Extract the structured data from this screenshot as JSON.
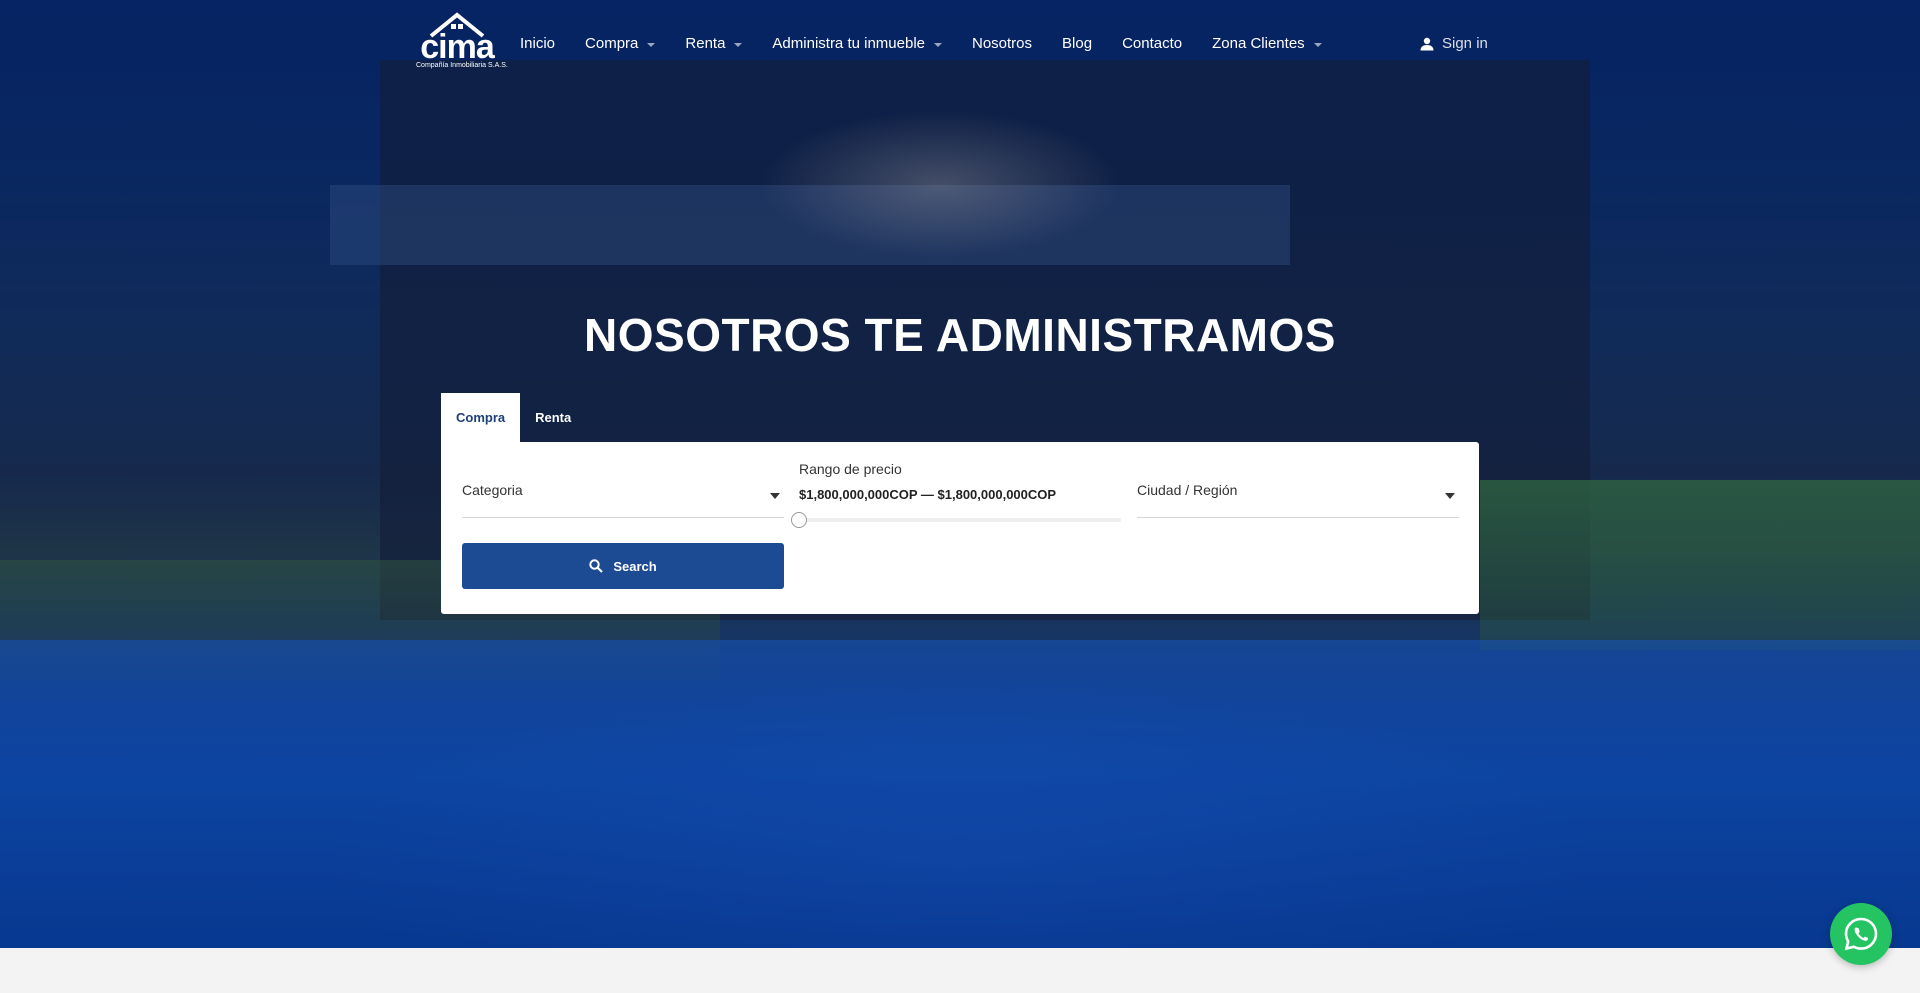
{
  "brand": {
    "name": "cima",
    "tagline": "Compañía Inmobiliaria S.A.S."
  },
  "nav": {
    "items": [
      {
        "label": "Inicio",
        "dropdown": false
      },
      {
        "label": "Compra",
        "dropdown": true
      },
      {
        "label": "Renta",
        "dropdown": true
      },
      {
        "label": "Administra tu inmueble",
        "dropdown": true
      },
      {
        "label": "Nosotros",
        "dropdown": false
      },
      {
        "label": "Blog",
        "dropdown": false
      },
      {
        "label": "Contacto",
        "dropdown": false
      },
      {
        "label": "Zona Clientes",
        "dropdown": true
      }
    ],
    "signin": "Sign in"
  },
  "hero": {
    "headline_light": "NOSOTROS TE",
    "headline_bold": "ADMINISTRAMOS"
  },
  "search": {
    "tabs": [
      {
        "label": "Compra",
        "active": true
      },
      {
        "label": "Renta",
        "active": false
      }
    ],
    "category_label": "Categoria",
    "price_label": "Rango de precio",
    "price_range": "$1,800,000,000COP — $1,800,000,000COP",
    "location_label": "Ciudad / Región",
    "button_label": "Search"
  },
  "icons": {
    "user": "user-icon",
    "search": "search-icon",
    "whatsapp": "whatsapp-icon"
  },
  "colors": {
    "primary": "#1c4a93",
    "whatsapp": "#25c463"
  }
}
